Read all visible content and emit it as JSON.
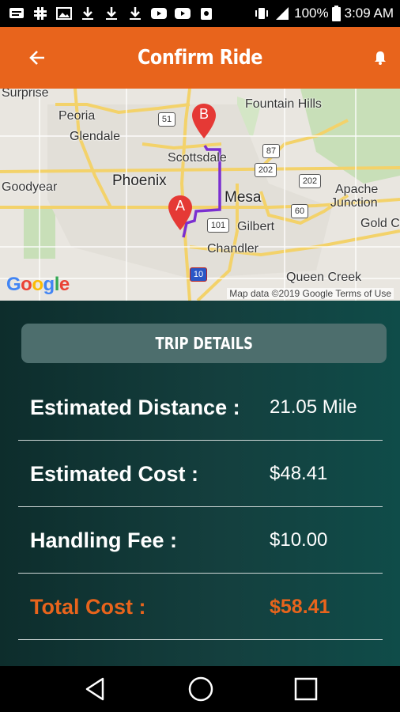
{
  "status_bar": {
    "battery_percent": "100%",
    "time": "3:09 AM"
  },
  "app_bar": {
    "title": "Confirm Ride",
    "back_icon": "arrow-left-icon",
    "notification_icon": "bell-icon"
  },
  "map": {
    "labels": {
      "surprise": "Surprise",
      "peoria": "Peoria",
      "glendale": "Glendale",
      "goodyear": "Goodyear",
      "phoenix": "Phoenix",
      "scottsdale": "Scottsdale",
      "fountain_hills": "Fountain Hills",
      "mesa": "Mesa",
      "gilbert": "Gilbert",
      "chandler": "Chandler",
      "apache_junction_1": "Apache",
      "apache_junction_2": "Junction",
      "gold_canyon": "Gold Ca",
      "queen_creek": "Queen Creek"
    },
    "highways": [
      "51",
      "87",
      "202",
      "202",
      "101",
      "60",
      "10"
    ],
    "markers": [
      "A",
      "B"
    ],
    "logo": "Google",
    "attribution": "Map data ©2019 Google   Terms of Use",
    "route_color": "#7b2fd0"
  },
  "trip": {
    "header": "TRIP DETAILS",
    "rows": [
      {
        "label": "Estimated Distance :",
        "value": "21.05 Mile"
      },
      {
        "label": "Estimated Cost :",
        "value": "$48.41"
      },
      {
        "label": "Handling Fee :",
        "value": "$10.00"
      },
      {
        "label": "Total Cost :",
        "value": "$58.41"
      }
    ],
    "accent_color": "#e8641c"
  },
  "nav_bar": {
    "back": "triangle-back-icon",
    "home": "circle-home-icon",
    "recents": "square-recents-icon"
  }
}
